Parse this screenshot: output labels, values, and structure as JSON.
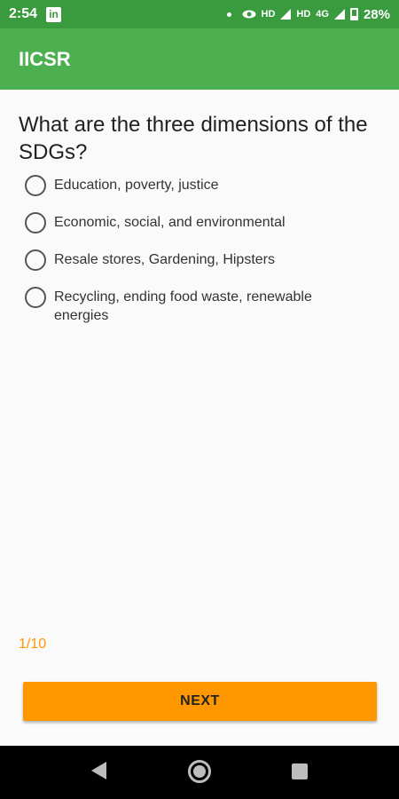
{
  "status_bar": {
    "time": "2:54",
    "linkedin_icon": "in",
    "hd1": "HD",
    "hd2": "HD",
    "network": "4G",
    "battery": "28%"
  },
  "app_bar": {
    "title": "IICSR"
  },
  "quiz": {
    "question": "What are the three dimensions of the SDGs?",
    "options": [
      "Education, poverty, justice",
      "Economic, social, and environmental",
      "Resale stores, Gardening, Hipsters",
      "Recycling, ending food waste, renewable energies"
    ],
    "progress": "1/10",
    "next_label": "NEXT"
  },
  "colors": {
    "status_bar": "#3a9b3e",
    "app_bar": "#4caf50",
    "accent": "#ff9800"
  },
  "icons": [
    "linkedin-icon",
    "eye-icon",
    "signal-icon",
    "battery-icon",
    "back-icon",
    "home-icon",
    "recents-icon"
  ]
}
